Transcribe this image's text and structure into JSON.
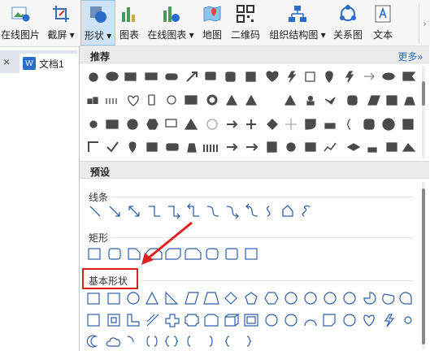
{
  "ribbon": {
    "items": [
      {
        "label": "在线图片",
        "icon": "online-picture-icon"
      },
      {
        "label": "截屏 ▾",
        "icon": "screenshot-icon"
      },
      {
        "label": "形状 ▾",
        "icon": "shapes-icon",
        "active": true
      },
      {
        "label": "图表",
        "icon": "chart-icon"
      },
      {
        "label": "在线图表 ▾",
        "icon": "online-chart-icon"
      },
      {
        "label": "地图",
        "icon": "map-icon"
      },
      {
        "label": "二维码",
        "icon": "qrcode-icon"
      },
      {
        "label": "组织结构图 ▾",
        "icon": "org-chart-icon"
      },
      {
        "label": "关系图",
        "icon": "relation-diagram-icon"
      },
      {
        "label": "文本",
        "icon": "textbox-icon"
      }
    ],
    "scroll_arrow": "›"
  },
  "doc": {
    "close_glyph": "×",
    "tab_label": "文档1",
    "tab_icon_text": "W"
  },
  "panel": {
    "recommended_title": "推荐",
    "more_label": "更多»",
    "preset_title": "预设",
    "lines_label": "线条",
    "rect_label": "矩形",
    "basic_label": "基本形状"
  },
  "colors": {
    "accent": "#2a6cc9",
    "active_bg": "#cfe3f7",
    "callout": "#e02020",
    "shape_dark": "#4a4a4a",
    "shape_outline": "#2f5fa8"
  }
}
